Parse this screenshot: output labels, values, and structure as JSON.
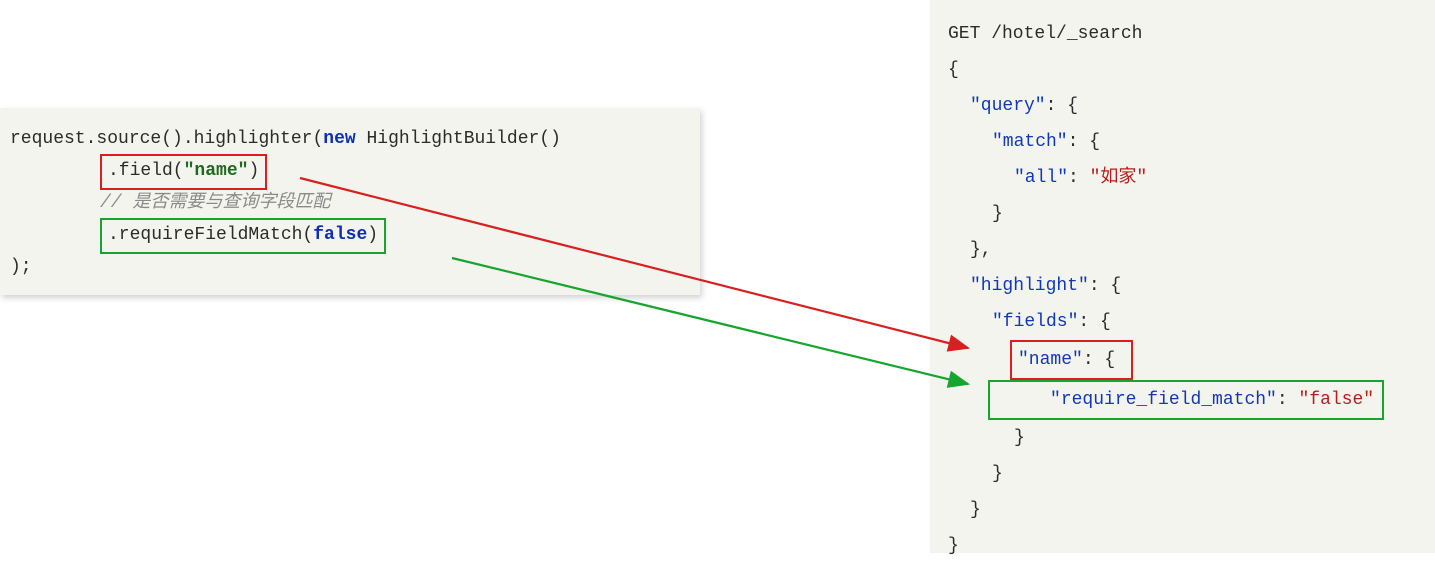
{
  "left": {
    "line1_pre": "request.source().highlighter(",
    "line1_new": "new",
    "line1_post": " HighlightBuilder()",
    "field_call_pre": ".field(",
    "field_call_arg": "\"name\"",
    "field_call_post": ")",
    "comment": "// 是否需要与查询字段匹配",
    "rfm_pre": ".requireFieldMatch(",
    "rfm_arg": "false",
    "rfm_post": ")",
    "close": ");"
  },
  "right": {
    "l1": "GET /hotel/_search",
    "l2": "{",
    "l3_key": "\"query\"",
    "l3_post": ": {",
    "l4_key": "\"match\"",
    "l4_post": ": {",
    "l5_key": "\"all\"",
    "l5_mid": ": ",
    "l5_val": "\"如家\"",
    "l6": "}",
    "l7": "},",
    "l8_key": "\"highlight\"",
    "l8_post": ": {",
    "l9_key": "\"fields\"",
    "l9_post": ": {",
    "l10_key": "\"name\"",
    "l10_post": ": {",
    "l11_key": "\"require_field_match\"",
    "l11_mid": ": ",
    "l11_val": "\"false\"",
    "l12": "}",
    "l13": "}",
    "l14": "}",
    "l15": "}"
  }
}
